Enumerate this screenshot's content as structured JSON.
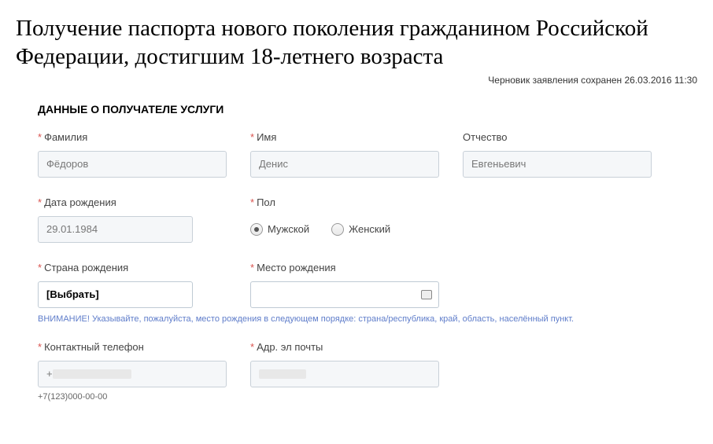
{
  "title": "Получение паспорта нового поколения гражданином Российской Федерации, достигшим 18-летнего возраста",
  "saved_note": "Черновик заявления сохранен 26.03.2016 11:30",
  "section_title": "ДАННЫЕ О ПОЛУЧАТЕЛЕ УСЛУГИ",
  "fields": {
    "surname": {
      "label": "Фамилия",
      "value": "Фёдоров",
      "required": true
    },
    "name": {
      "label": "Имя",
      "value": "Денис",
      "required": true
    },
    "patronymic": {
      "label": "Отчество",
      "value": "Евгеньевич",
      "required": false
    },
    "dob": {
      "label": "Дата рождения",
      "value": "29.01.1984",
      "required": true
    },
    "gender": {
      "label": "Пол",
      "required": true,
      "options": {
        "male": "Мужской",
        "female": "Женский"
      },
      "selected": "male"
    },
    "birth_country": {
      "label": "Страна рождения",
      "value": "[Выбрать]",
      "required": true
    },
    "birth_place": {
      "label": "Место рождения",
      "value": "",
      "required": true
    },
    "phone": {
      "label": "Контактный телефон",
      "value": "+",
      "hint": "+7(123)000-00-00",
      "required": true
    },
    "email": {
      "label": "Адр. эл почты",
      "value": "",
      "required": true
    }
  },
  "note": "ВНИМАНИЕ! Указывайте, пожалуйста, место рождения в следующем порядке: страна/республика, край, область, населённый пункт."
}
